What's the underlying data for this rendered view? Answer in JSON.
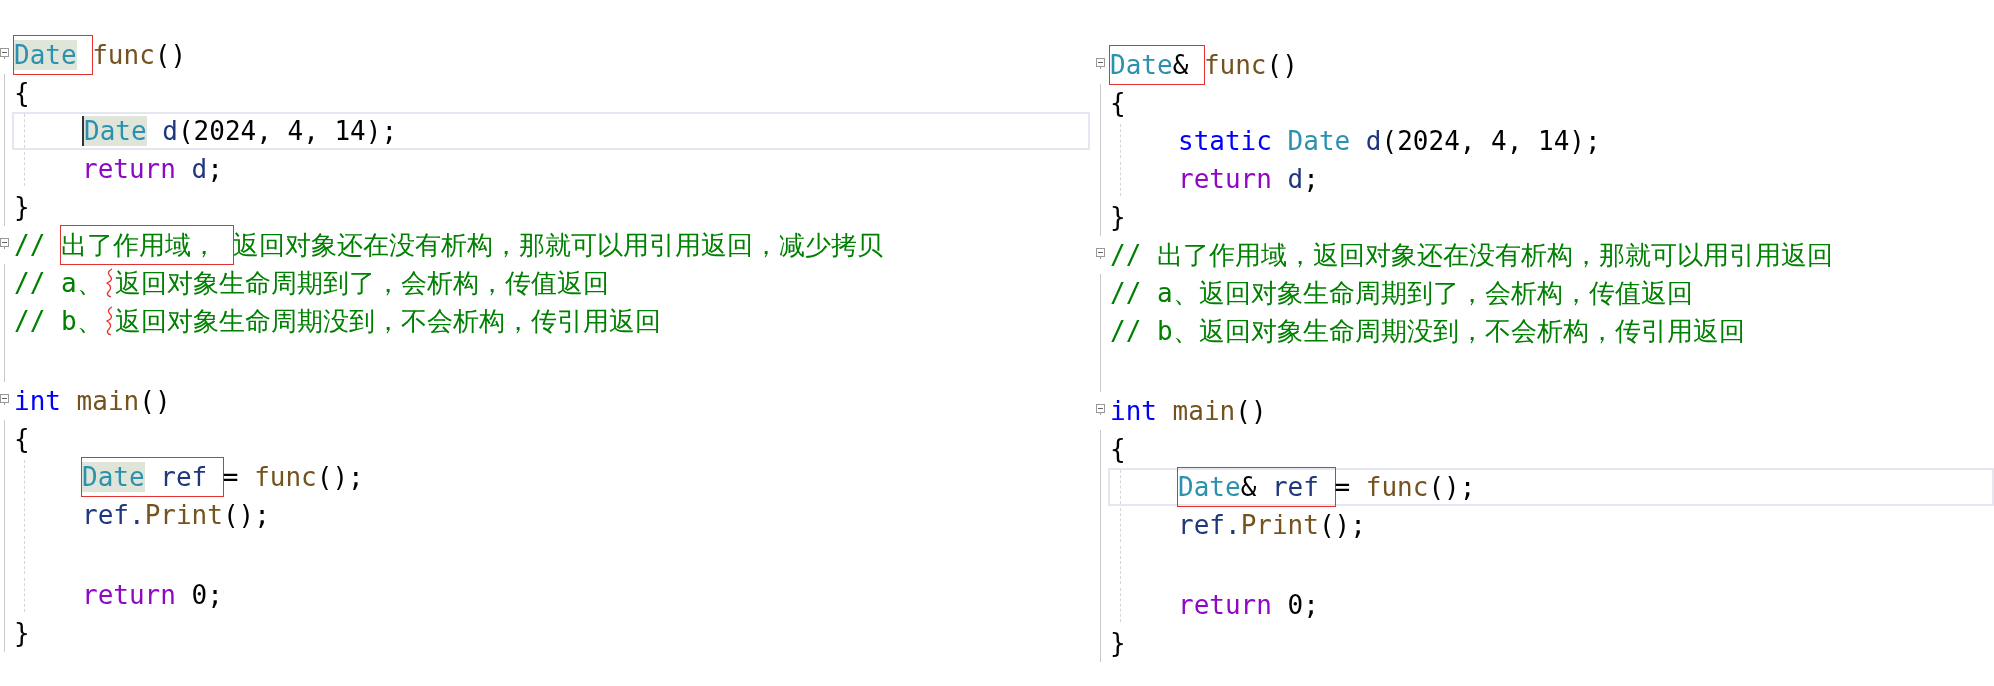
{
  "panels": [
    {
      "lines": [
        {
          "fold": true,
          "indented": false,
          "current": false,
          "caret": false,
          "parts": [
            {
              "kind": "box",
              "tokens": [
                {
                  "text": "Date",
                  "kind": "type",
                  "highlighted": true
                }
              ]
            },
            {
              "kind": "code",
              "tokens": [
                {
                  "text": "func",
                  "kind": "func"
                },
                {
                  "text": "()",
                  "kind": "plain"
                }
              ]
            }
          ]
        },
        {
          "fold": false,
          "indented": false,
          "current": false,
          "caret": false,
          "parts": [
            {
              "kind": "code",
              "tokens": [
                {
                  "text": "{",
                  "kind": "plain"
                }
              ]
            }
          ]
        },
        {
          "fold": false,
          "indented": true,
          "current": true,
          "caret": true,
          "parts": [
            {
              "kind": "code",
              "tokens": [
                {
                  "text": "Date",
                  "kind": "type",
                  "highlighted": true
                },
                {
                  "text": " d",
                  "kind": "var"
                },
                {
                  "text": "(2024, 4, 14);",
                  "kind": "plain"
                }
              ]
            }
          ]
        },
        {
          "fold": false,
          "indented": true,
          "current": false,
          "caret": false,
          "parts": [
            {
              "kind": "code",
              "tokens": [
                {
                  "text": "return",
                  "kind": "control"
                },
                {
                  "text": " d",
                  "kind": "var"
                },
                {
                  "text": ";",
                  "kind": "plain"
                }
              ]
            }
          ]
        },
        {
          "fold": false,
          "indented": false,
          "current": false,
          "caret": false,
          "parts": [
            {
              "kind": "code",
              "tokens": [
                {
                  "text": "}",
                  "kind": "plain"
                }
              ]
            }
          ]
        },
        {
          "fold": true,
          "indented": false,
          "current": false,
          "caret": false,
          "parts": [
            {
              "kind": "code",
              "tokens": [
                {
                  "text": "// ",
                  "kind": "comment"
                }
              ]
            },
            {
              "kind": "box",
              "tokens": [
                {
                  "text": "出了作用域，",
                  "kind": "comment"
                }
              ]
            },
            {
              "kind": "code",
              "tokens": [
                {
                  "text": "返回对象还在没有析构，那就可以用引用返回，减少拷贝",
                  "kind": "comment"
                }
              ]
            }
          ]
        },
        {
          "fold": false,
          "indented": false,
          "current": false,
          "caret": false,
          "parts": [
            {
              "kind": "code",
              "tokens": [
                {
                  "text": "// a、",
                  "kind": "comment"
                }
              ]
            },
            {
              "kind": "squiggle"
            },
            {
              "kind": "code",
              "tokens": [
                {
                  "text": "返回对象生命周期到了，会析构，传值返回",
                  "kind": "comment"
                }
              ]
            }
          ]
        },
        {
          "fold": false,
          "indented": false,
          "current": false,
          "caret": false,
          "parts": [
            {
              "kind": "code",
              "tokens": [
                {
                  "text": "// b、",
                  "kind": "comment"
                }
              ]
            },
            {
              "kind": "squiggle"
            },
            {
              "kind": "code",
              "tokens": [
                {
                  "text": "返回对象生命周期没到，不会析构，传引用返回",
                  "kind": "comment"
                }
              ]
            }
          ]
        },
        {
          "fold": false,
          "indented": false,
          "current": false,
          "caret": false
        },
        {
          "fold": true,
          "indented": false,
          "current": false,
          "caret": false,
          "parts": [
            {
              "kind": "code",
              "tokens": [
                {
                  "text": "int",
                  "kind": "keyword"
                },
                {
                  "text": " main",
                  "kind": "func"
                },
                {
                  "text": "()",
                  "kind": "plain"
                }
              ]
            }
          ]
        },
        {
          "fold": false,
          "indented": false,
          "current": false,
          "caret": false,
          "parts": [
            {
              "kind": "code",
              "tokens": [
                {
                  "text": "{",
                  "kind": "plain"
                }
              ]
            }
          ]
        },
        {
          "fold": false,
          "indented": true,
          "current": false,
          "caret": false,
          "parts": [
            {
              "kind": "box",
              "tokens": [
                {
                  "text": "Date",
                  "kind": "type",
                  "highlighted": true
                },
                {
                  "text": " ref",
                  "kind": "var"
                }
              ]
            },
            {
              "kind": "code",
              "tokens": [
                {
                  "text": "= ",
                  "kind": "plain"
                },
                {
                  "text": "func",
                  "kind": "func"
                },
                {
                  "text": "();",
                  "kind": "plain"
                }
              ]
            }
          ]
        },
        {
          "fold": false,
          "indented": true,
          "current": false,
          "caret": false,
          "parts": [
            {
              "kind": "code",
              "tokens": [
                {
                  "text": "ref.",
                  "kind": "var"
                },
                {
                  "text": "Print",
                  "kind": "func"
                },
                {
                  "text": "();",
                  "kind": "plain"
                }
              ]
            }
          ]
        },
        {
          "fold": false,
          "indented": true,
          "current": false,
          "caret": false
        },
        {
          "fold": false,
          "indented": true,
          "current": false,
          "caret": false,
          "parts": [
            {
              "kind": "code",
              "tokens": [
                {
                  "text": "return",
                  "kind": "control"
                },
                {
                  "text": " 0;",
                  "kind": "plain"
                }
              ]
            }
          ]
        },
        {
          "fold": false,
          "indented": false,
          "current": false,
          "caret": false,
          "parts": [
            {
              "kind": "code",
              "tokens": [
                {
                  "text": "}",
                  "kind": "plain"
                }
              ]
            }
          ]
        }
      ]
    },
    {
      "lines": [
        {
          "fold": true,
          "indented": false,
          "current": false,
          "caret": false,
          "parts": [
            {
              "kind": "box",
              "tokens": [
                {
                  "text": "Date",
                  "kind": "type",
                  "highlighted": false
                },
                {
                  "text": "&",
                  "kind": "plain"
                }
              ]
            },
            {
              "kind": "code",
              "tokens": [
                {
                  "text": "func",
                  "kind": "func"
                },
                {
                  "text": "()",
                  "kind": "plain"
                }
              ]
            }
          ]
        },
        {
          "fold": false,
          "indented": false,
          "current": false,
          "caret": false,
          "parts": [
            {
              "kind": "code",
              "tokens": [
                {
                  "text": "{",
                  "kind": "plain"
                }
              ]
            }
          ]
        },
        {
          "fold": false,
          "indented": true,
          "current": false,
          "caret": false,
          "parts": [
            {
              "kind": "code",
              "tokens": [
                {
                  "text": "static",
                  "kind": "keyword"
                },
                {
                  "text": " Date",
                  "kind": "type",
                  "highlighted": false
                },
                {
                  "text": " d",
                  "kind": "var"
                },
                {
                  "text": "(2024, 4, 14);",
                  "kind": "plain"
                }
              ]
            }
          ]
        },
        {
          "fold": false,
          "indented": true,
          "current": false,
          "caret": false,
          "parts": [
            {
              "kind": "code",
              "tokens": [
                {
                  "text": "return",
                  "kind": "control"
                },
                {
                  "text": " d",
                  "kind": "var"
                },
                {
                  "text": ";",
                  "kind": "plain"
                }
              ]
            }
          ]
        },
        {
          "fold": false,
          "indented": false,
          "current": false,
          "caret": false,
          "parts": [
            {
              "kind": "code",
              "tokens": [
                {
                  "text": "}",
                  "kind": "plain"
                }
              ]
            }
          ]
        },
        {
          "fold": true,
          "indented": false,
          "current": false,
          "caret": false,
          "parts": [
            {
              "kind": "code",
              "tokens": [
                {
                  "text": "// 出了作用域，返回对象还在没有析构，那就可以用引用返回",
                  "kind": "comment"
                }
              ]
            }
          ]
        },
        {
          "fold": false,
          "indented": false,
          "current": false,
          "caret": false,
          "parts": [
            {
              "kind": "code",
              "tokens": [
                {
                  "text": "// a、返回对象生命周期到了，会析构，传值返回",
                  "kind": "comment"
                }
              ]
            }
          ]
        },
        {
          "fold": false,
          "indented": false,
          "current": false,
          "caret": false,
          "parts": [
            {
              "kind": "code",
              "tokens": [
                {
                  "text": "// b、返回对象生命周期没到，不会析构，传引用返回",
                  "kind": "comment"
                }
              ]
            }
          ]
        },
        {
          "fold": false,
          "indented": false,
          "current": false,
          "caret": false
        },
        {
          "fold": true,
          "indented": false,
          "current": false,
          "caret": false,
          "parts": [
            {
              "kind": "code",
              "tokens": [
                {
                  "text": "int",
                  "kind": "keyword"
                },
                {
                  "text": " main",
                  "kind": "func"
                },
                {
                  "text": "()",
                  "kind": "plain"
                }
              ]
            }
          ]
        },
        {
          "fold": false,
          "indented": false,
          "current": false,
          "caret": false,
          "parts": [
            {
              "kind": "code",
              "tokens": [
                {
                  "text": "{",
                  "kind": "plain"
                }
              ]
            }
          ]
        },
        {
          "fold": false,
          "indented": true,
          "current": true,
          "caret": false,
          "parts": [
            {
              "kind": "box",
              "tokens": [
                {
                  "text": "Date",
                  "kind": "type",
                  "highlighted": false
                },
                {
                  "text": "&",
                  "kind": "plain"
                },
                {
                  "text": " ref",
                  "kind": "var"
                }
              ]
            },
            {
              "kind": "code",
              "tokens": [
                {
                  "text": "= ",
                  "kind": "plain"
                },
                {
                  "text": "func",
                  "kind": "func"
                },
                {
                  "text": "();",
                  "kind": "plain"
                }
              ]
            }
          ]
        },
        {
          "fold": false,
          "indented": true,
          "current": false,
          "caret": false,
          "parts": [
            {
              "kind": "code",
              "tokens": [
                {
                  "text": "ref.",
                  "kind": "var"
                },
                {
                  "text": "Print",
                  "kind": "func"
                },
                {
                  "text": "();",
                  "kind": "plain"
                }
              ]
            }
          ]
        },
        {
          "fold": false,
          "indented": true,
          "current": false,
          "caret": false
        },
        {
          "fold": false,
          "indented": true,
          "current": false,
          "caret": false,
          "parts": [
            {
              "kind": "code",
              "tokens": [
                {
                  "text": "return",
                  "kind": "control"
                },
                {
                  "text": " 0;",
                  "kind": "plain"
                }
              ]
            }
          ]
        },
        {
          "fold": false,
          "indented": false,
          "current": false,
          "caret": false,
          "parts": [
            {
              "kind": "code",
              "tokens": [
                {
                  "text": "}",
                  "kind": "plain"
                }
              ]
            }
          ]
        }
      ]
    }
  ]
}
